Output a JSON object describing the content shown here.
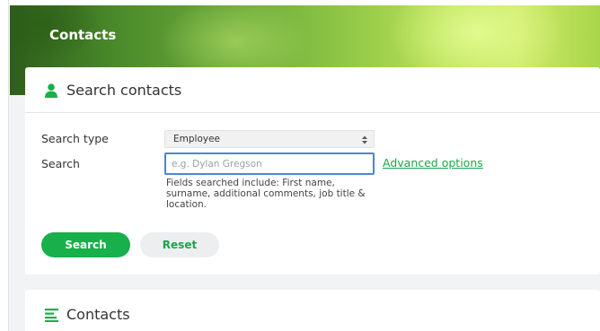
{
  "banner": {
    "title": "Contacts"
  },
  "search_card": {
    "title": "Search contacts",
    "icon": "person-icon",
    "search_type": {
      "label": "Search type",
      "selected": "Employee"
    },
    "search": {
      "label": "Search",
      "placeholder": "e.g. Dylan Gregson",
      "value": "",
      "advanced_link": "Advanced options",
      "helper_lines": [
        "Fields searched include: First name,",
        "surname, additional comments, job title &",
        "location."
      ]
    },
    "buttons": {
      "search": "Search",
      "reset": "Reset"
    }
  },
  "contacts_card": {
    "title": "Contacts",
    "icon": "list-icon"
  },
  "colors": {
    "accent_green": "#17b04a",
    "link_green": "#1fa34a",
    "focus_blue": "#4a86d6",
    "page_bg": "#f2f3f4"
  }
}
